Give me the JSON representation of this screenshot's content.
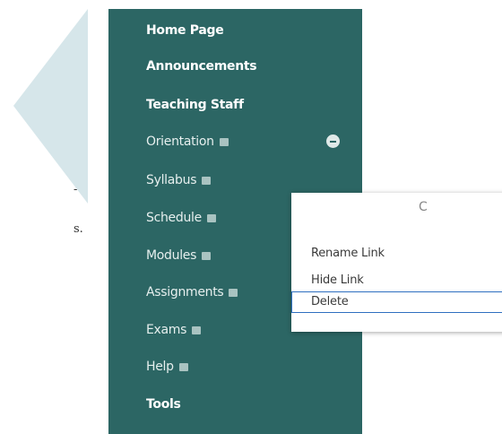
{
  "callout": {
    "color": "#d6e6ea",
    "fragment_line1": "-",
    "fragment_line2": "s."
  },
  "sidebar": {
    "background": "#2c6664",
    "items": [
      {
        "label": "Home Page",
        "hidden": false
      },
      {
        "label": "Announcements",
        "hidden": false
      },
      {
        "label": "Teaching Staff",
        "hidden": false
      },
      {
        "label": "Orientation",
        "hidden": true
      },
      {
        "label": "Syllabus",
        "hidden": true
      },
      {
        "label": "Schedule",
        "hidden": true
      },
      {
        "label": "Modules",
        "hidden": true
      },
      {
        "label": "Assignments",
        "hidden": true
      },
      {
        "label": "Exams",
        "hidden": true
      },
      {
        "label": "Help",
        "hidden": true
      },
      {
        "label": "Tools",
        "hidden": false
      }
    ]
  },
  "context_menu": {
    "close_glyph": "C",
    "items": [
      {
        "label": "Rename Link"
      },
      {
        "label": "Hide Link"
      },
      {
        "label": "Delete",
        "selected": true
      }
    ]
  }
}
